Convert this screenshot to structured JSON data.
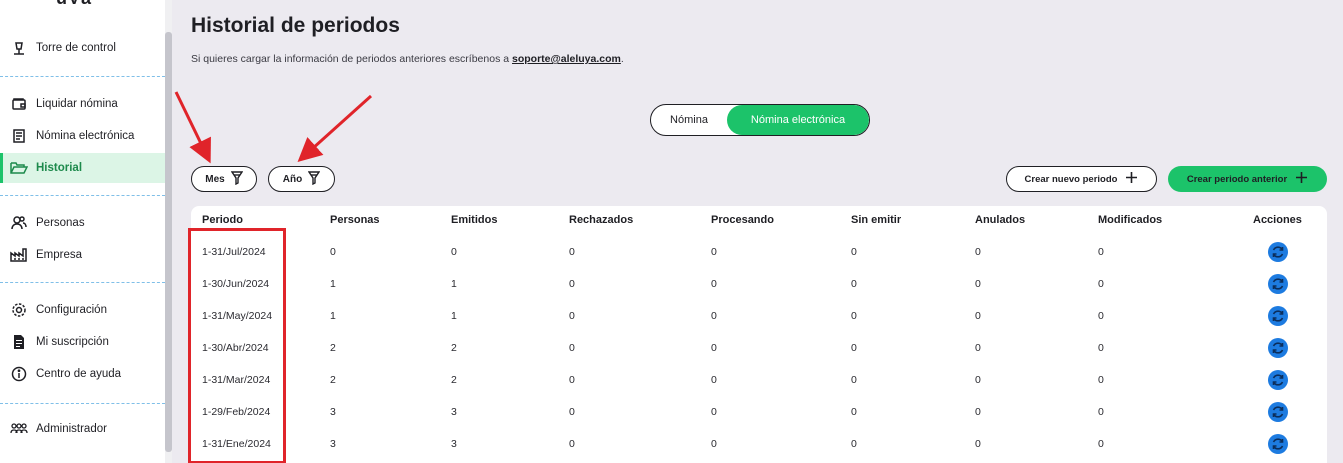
{
  "sidebar": {
    "items": [
      {
        "label": "Torre de control",
        "icon": "control-tower-icon",
        "active": false
      },
      {
        "label": "Liquidar nómina",
        "icon": "wallet-icon",
        "active": false
      },
      {
        "label": "Nómina electrónica",
        "icon": "document-icon",
        "active": false
      },
      {
        "label": "Historial",
        "icon": "folder-open-icon",
        "active": true
      },
      {
        "label": "Personas",
        "icon": "people-icon",
        "active": false
      },
      {
        "label": "Empresa",
        "icon": "factory-icon",
        "active": false
      },
      {
        "label": "Configuración",
        "icon": "gear-icon",
        "active": false
      },
      {
        "label": "Mi suscripción",
        "icon": "receipt-icon",
        "active": false
      },
      {
        "label": "Centro de ayuda",
        "icon": "info-icon",
        "active": false
      },
      {
        "label": "Administrador",
        "icon": "admin-users-icon",
        "active": false
      }
    ]
  },
  "header": {
    "title": "Historial de periodos",
    "subtitle_prefix": "Si quieres cargar la información de periodos anteriores escríbenos a ",
    "email": "soporte@aleluya.com",
    "subtitle_suffix": "."
  },
  "toggle": {
    "option_a": "Nómina",
    "option_b": "Nómina electrónica",
    "selected": "Nómina electrónica"
  },
  "filters": {
    "month": "Mes",
    "year": "Año"
  },
  "buttons": {
    "create_new": "Crear nuevo periodo",
    "create_previous": "Crear periodo anterior"
  },
  "table": {
    "headers": [
      "Periodo",
      "Personas",
      "Emitidos",
      "Rechazados",
      "Procesando",
      "Sin emitir",
      "Anulados",
      "Modificados",
      "Acciones"
    ],
    "rows": [
      [
        "1-31/Jul/2024",
        "0",
        "0",
        "0",
        "0",
        "0",
        "0",
        "0"
      ],
      [
        "1-30/Jun/2024",
        "1",
        "1",
        "0",
        "0",
        "0",
        "0",
        "0"
      ],
      [
        "1-31/May/2024",
        "1",
        "1",
        "0",
        "0",
        "0",
        "0",
        "0"
      ],
      [
        "1-30/Abr/2024",
        "2",
        "2",
        "0",
        "0",
        "0",
        "0",
        "0"
      ],
      [
        "1-31/Mar/2024",
        "2",
        "2",
        "0",
        "0",
        "0",
        "0",
        "0"
      ],
      [
        "1-29/Feb/2024",
        "3",
        "3",
        "0",
        "0",
        "0",
        "0",
        "0"
      ],
      [
        "1-31/Ene/2024",
        "3",
        "3",
        "0",
        "0",
        "0",
        "0",
        "0"
      ]
    ]
  },
  "colors": {
    "accent": "#1cc36a",
    "action": "#1d7be0",
    "annotation": "#e0242a"
  }
}
